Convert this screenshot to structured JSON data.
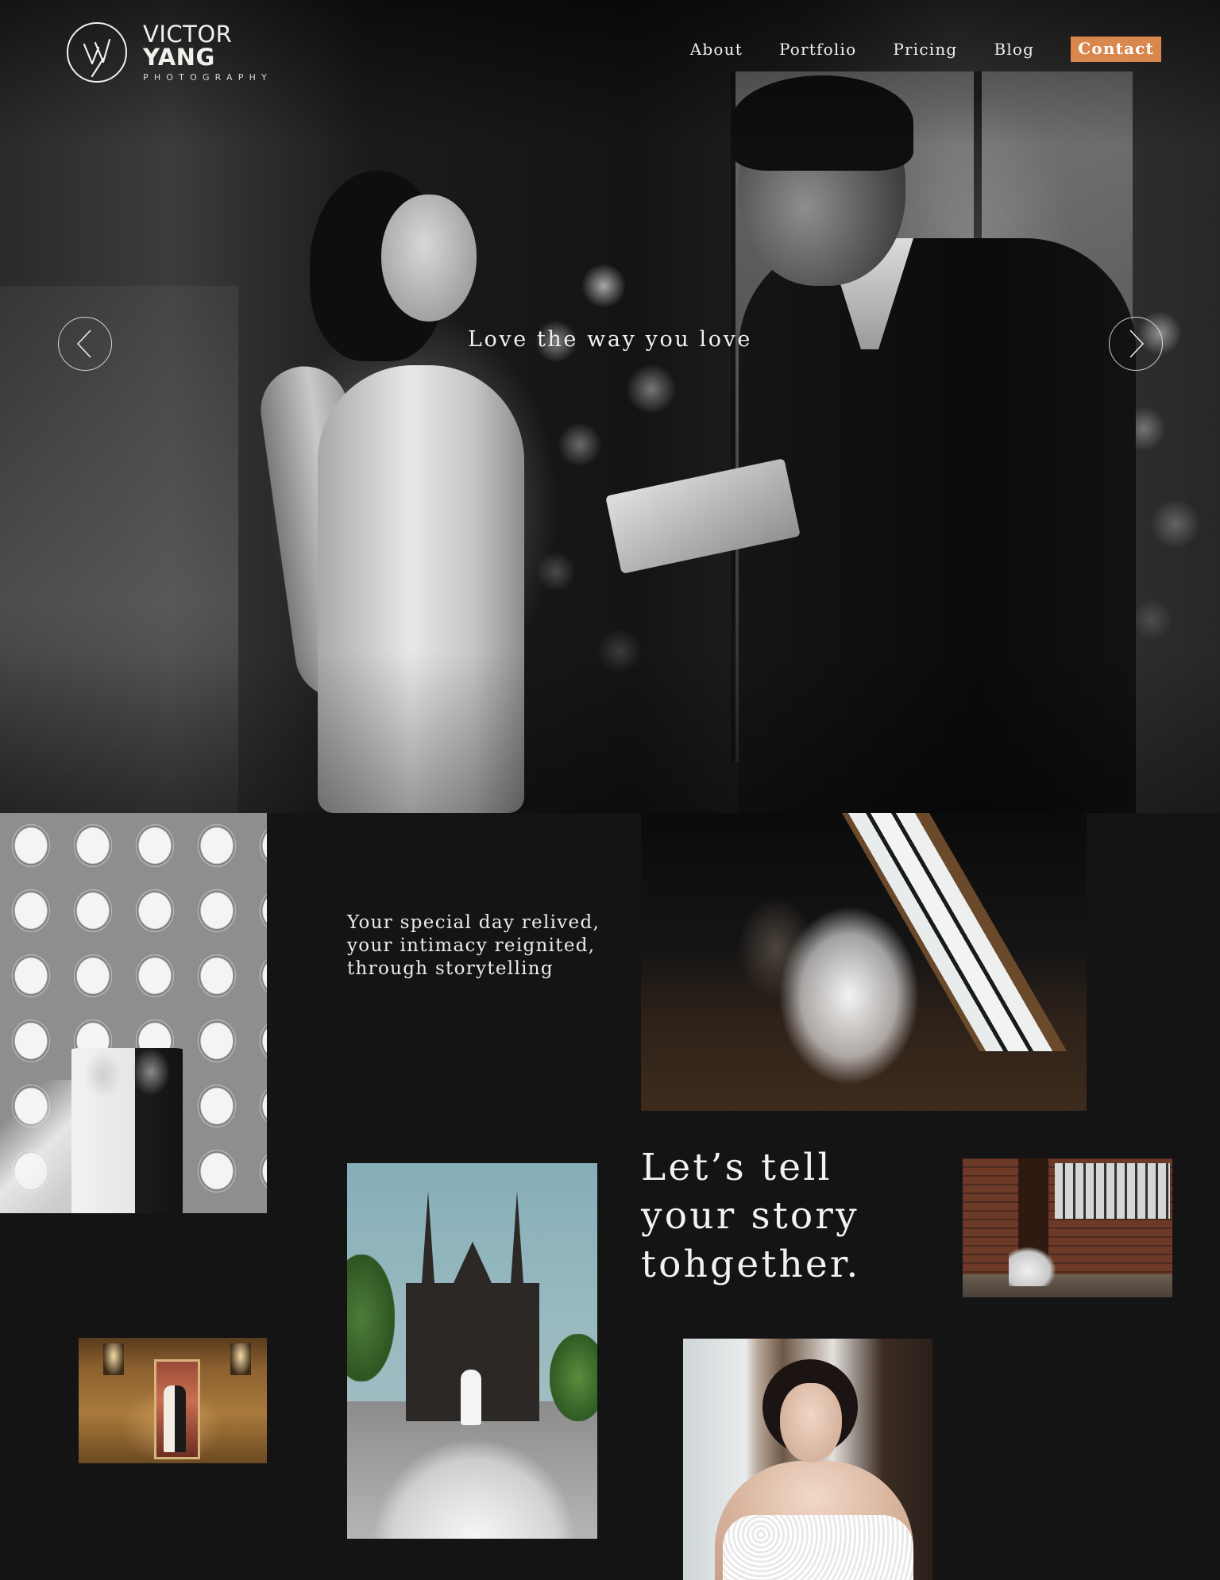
{
  "brand": {
    "name_light": "VICTOR",
    "name_bold": "YANG",
    "sub": "PHOTOGRAPHY",
    "mark_icon": "vy-monogram-icon"
  },
  "nav": {
    "items": [
      {
        "label": "About"
      },
      {
        "label": "Portfolio"
      },
      {
        "label": "Pricing"
      },
      {
        "label": "Blog"
      }
    ],
    "contact": "Contact"
  },
  "hero": {
    "tagline": "Love the way you love",
    "prev_icon": "chevron-left-icon",
    "next_icon": "chevron-right-icon"
  },
  "intro": {
    "line1": "Your special day relived,",
    "line2": "your intimacy reignited,",
    "line3": "through storytelling"
  },
  "heading": {
    "line1": "Let’s tell",
    "line2": "your story",
    "line3": "tohgether."
  },
  "colors": {
    "background": "#141415",
    "accent": "#d9874c",
    "text": "#f2f0ec"
  }
}
